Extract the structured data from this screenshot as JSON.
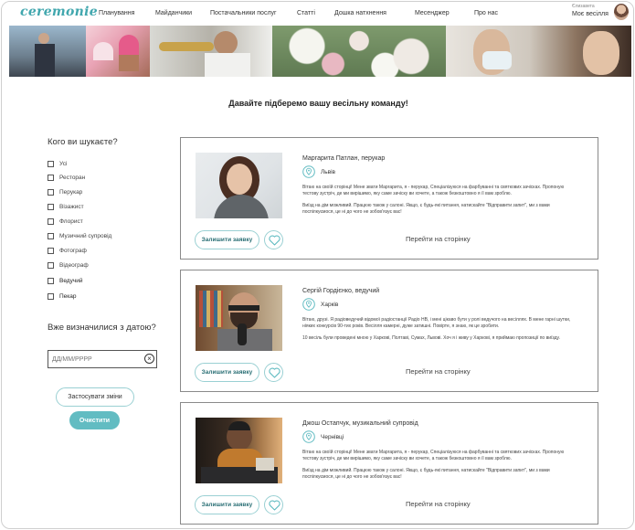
{
  "header": {
    "logo": "ceremonie",
    "nav": [
      "Планування",
      "Майданчики",
      "Постачальники послуг",
      "Статті",
      "Дошка натхнення",
      "Месенджер",
      "Про нас"
    ],
    "profile_label": "Моє весілля",
    "profile_small": "Єлизавета"
  },
  "headline": "Давайте підберемо вашу весільну команду!",
  "filters": {
    "title": "Кого ви шукаєте?",
    "options": [
      "Усі",
      "Ресторан",
      "Перукар",
      "Візажист",
      "Флорист",
      "Музичний супровід",
      "Фотограф",
      "Відеограф",
      "Ведучий",
      "Пекар"
    ],
    "date_title": "Вже визначилися з датою?",
    "date_placeholder": "ДД/ММ/РРРР",
    "apply_label": "Застосувати зміни",
    "reset_label": "Очистити"
  },
  "cards": [
    {
      "name": "Маргарита Патлан, перукар",
      "city": "Львів",
      "desc1": "Вітаю на своїй сторінці! Мене звати Маргарита, я - перукар, Спеціалізуюся на фарбуванні та святкових зачісках. Пропоную тестову зустріч, де ми вирішимо, яку саме зачіску ви хочете, а також безкоштовно я її вам зроблю.",
      "desc2": "Виїзд на дім можливий. Працюю також у салоні. Якщо, є будь-які питання, натискайте \"Відправити запит\", ми з вами поспілкуємося, це ні до чого не зобов'язує вас!",
      "apply_label": "Залишити заявку",
      "goto_label": "Перейти на сторінку"
    },
    {
      "name": "Сергій Гордієнко, ведучий",
      "city": "Харків",
      "desc1": "Вітаю, друзі. Я радіоведучий відомої радіостанції Радіо НВ, і мені цікаво бути у ролі ведучого на весіллях. В мене гарні шутки, ніяких конкурсів 90-тих років. Весілля камерні, дуже затишні. Повірте, я знаю, як це зробити.",
      "desc2": "10 весіль були проведені мною у Харкові, Полтаві, Сумах, Львові. Хоч я і живу у Харкові, я приймаю пропозиції по виїзду.",
      "apply_label": "Залишити заявку",
      "goto_label": "Перейти на сторінку"
    },
    {
      "name": "Джош Остапчук, музикальний супровід",
      "city": "Чернівці",
      "desc1": "Вітаю на своїй сторінці! Мене звати Маргарита, я - перукар, Спеціалізуюся на фарбуванні та святкових зачісках. Пропоную тестову зустріч, де ми вирішимо, яку саме зачіску ви хочете, а також безкоштовно я її вам зроблю.",
      "desc2": "Виїзд на дім можливий. Працюю також у салоні. Якщо, є будь-які питання, натискайте \"Відправити запит\", ми з вами поспілкуємося, це ні до чого не зобов'язує вас!",
      "apply_label": "Залишити заявку",
      "goto_label": "Перейти на сторінку"
    }
  ],
  "colors": {
    "accent": "#62bcc2",
    "logo": "#41a7ae",
    "border": "#8a8a8a"
  },
  "icons": {
    "location": "map-pin-icon",
    "favorite": "heart-icon",
    "clear": "close-circle-icon"
  }
}
